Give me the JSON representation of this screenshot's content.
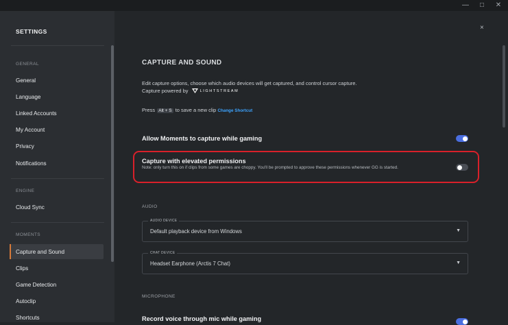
{
  "window": {
    "minimize": "—",
    "maximize": "□",
    "close": "✕"
  },
  "sidebar": {
    "title": "SETTINGS",
    "sections": [
      {
        "label": "GENERAL",
        "items": [
          "General",
          "Language",
          "Linked Accounts",
          "My Account",
          "Privacy",
          "Notifications"
        ]
      },
      {
        "label": "ENGINE",
        "items": [
          "Cloud Sync"
        ]
      },
      {
        "label": "MOMENTS",
        "items": [
          "Capture and Sound",
          "Clips",
          "Game Detection",
          "Autoclip",
          "Shortcuts"
        ]
      }
    ],
    "active_item": "Capture and Sound",
    "accent": "#d87a39"
  },
  "main": {
    "close": "×",
    "title": "CAPTURE AND SOUND",
    "description": "Edit capture options, choose which audio devices will get captured, and control cursor capture.",
    "powered_by": "Capture powered by",
    "brand": "LIGHTSTREAM",
    "shortcut": {
      "prefix": "Press",
      "key1": "Alt",
      "plus": "+",
      "key2": "S",
      "suffix": "to save a new clip",
      "link": "Change Shortcut"
    },
    "settings": [
      {
        "title": "Allow Moments to capture while gaming",
        "toggle": "on"
      },
      {
        "title": "Capture with elevated permissions",
        "note": "Note: only turn this on if clips from some games are choppy. You'll be prompted to approve these permissions whenever GG is started.",
        "toggle": "off"
      }
    ],
    "audio": {
      "label": "AUDIO",
      "audio_device": {
        "legend": "AUDIO DEVICE",
        "value": "Default playback device from Windows"
      },
      "chat_device": {
        "legend": "CHAT DEVICE",
        "value": "Headset Earphone (Arctis 7 Chat)"
      }
    },
    "microphone": {
      "label": "MICROPHONE",
      "record_title": "Record voice through mic while gaming"
    },
    "toggle_on_color": "#4a6ee0",
    "highlight_color": "#d9202a"
  }
}
